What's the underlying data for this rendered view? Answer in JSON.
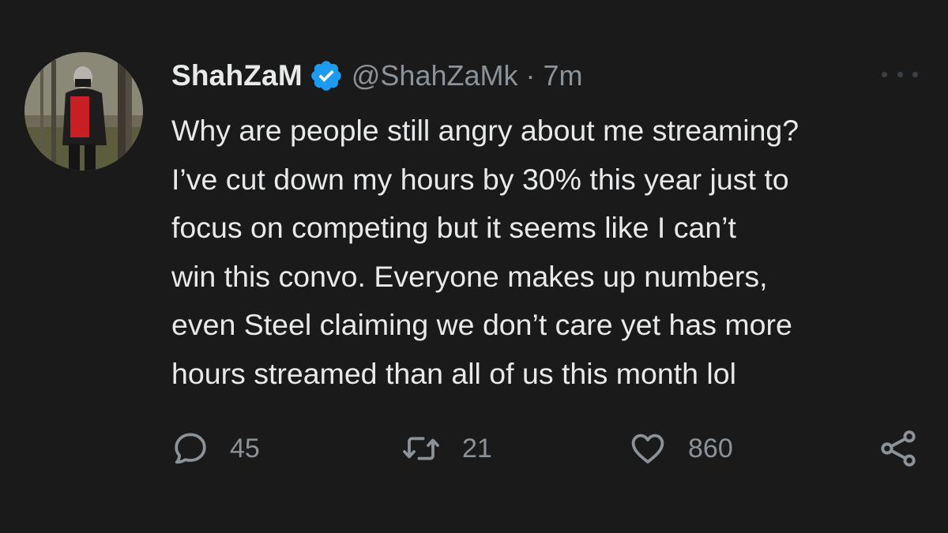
{
  "tweet": {
    "author": {
      "display_name": "ShahZaM",
      "handle": "@ShahZaMk",
      "verified": true,
      "avatar_icon": "profile-photo"
    },
    "timestamp": "7m",
    "separator": "·",
    "text_lines": [
      "Why are people still angry about me streaming?",
      "I’ve cut down my hours by 30% this year just to",
      "focus on competing but it seems like I can’t",
      "win this convo. Everyone makes up numbers,",
      "even Steel claiming we don’t care yet has more",
      "hours streamed than all of us this month lol"
    ],
    "actions": {
      "replies": "45",
      "retweets": "21",
      "likes": "860",
      "reply_icon": "speech-bubble-icon",
      "retweet_icon": "retweet-arrows-icon",
      "like_icon": "heart-icon",
      "share_icon": "share-nodes-icon"
    },
    "more_icon": "ellipsis-icon"
  },
  "colors": {
    "background": "#1a1a1a",
    "text_primary": "#e7e9ea",
    "text_secondary": "#8b9298",
    "verified_badge": "#1d9bf0"
  }
}
